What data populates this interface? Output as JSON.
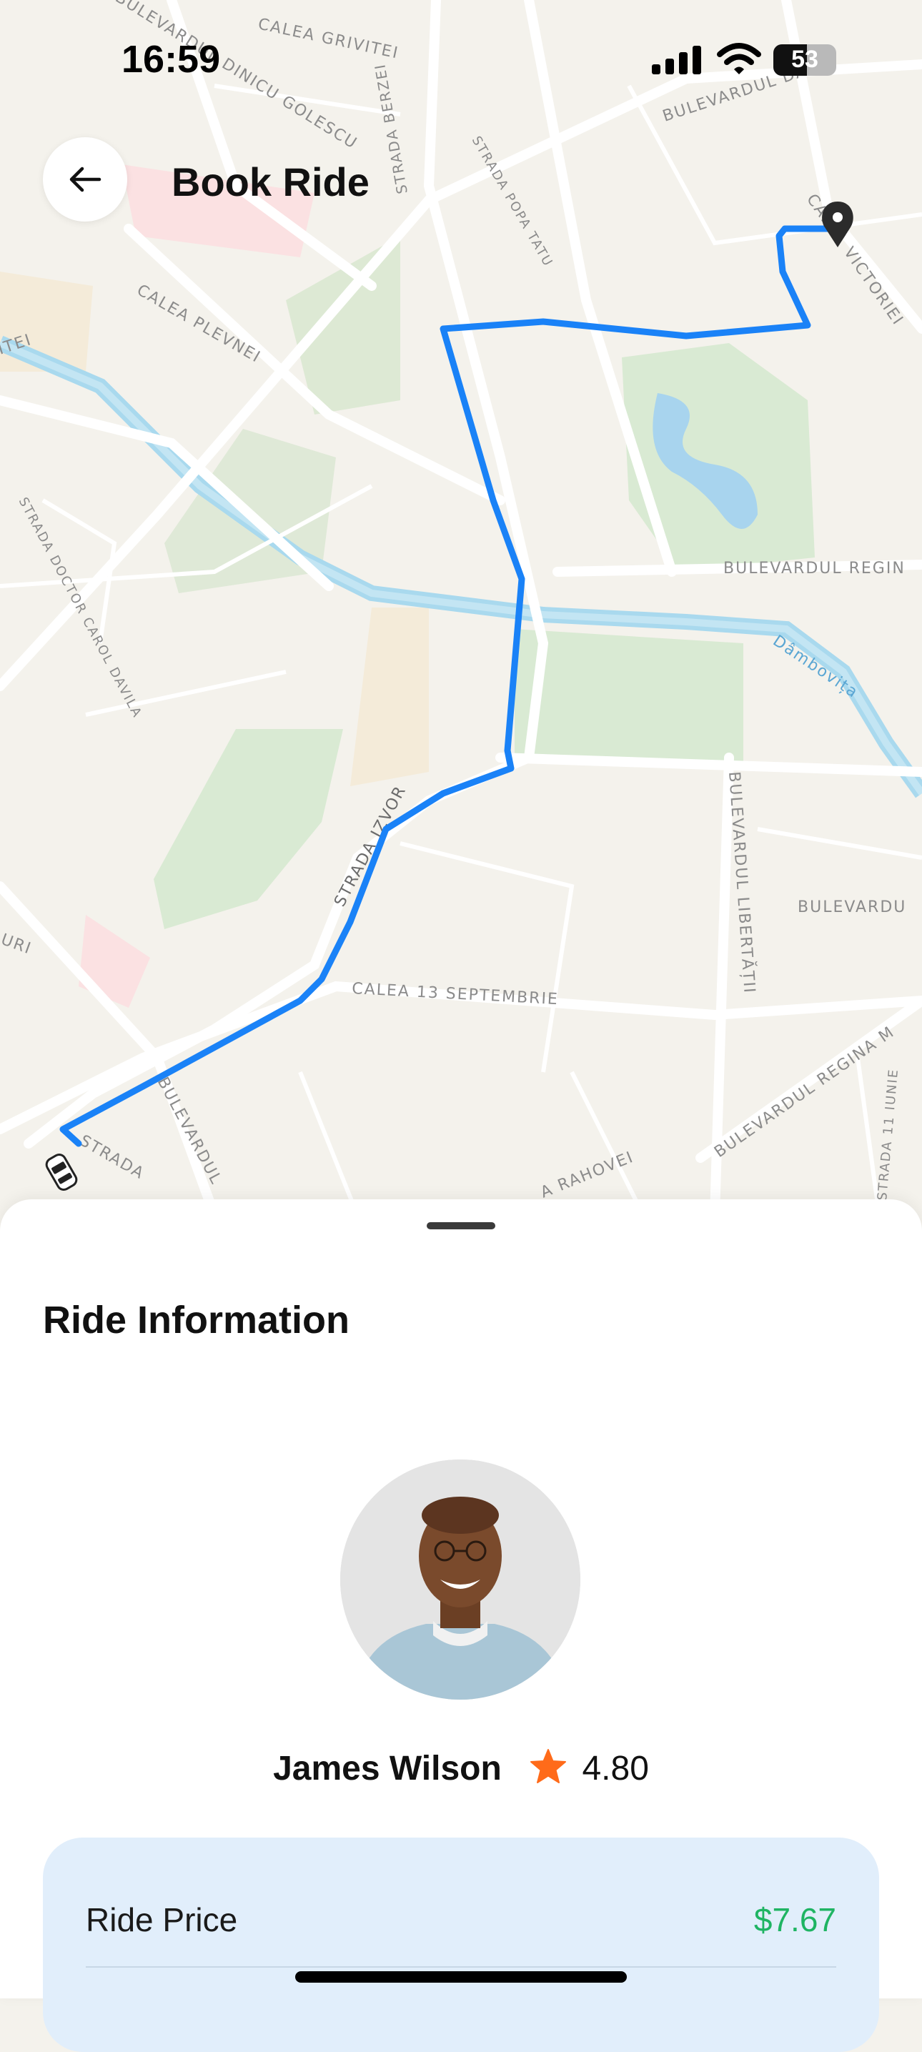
{
  "status_bar": {
    "time": "16:59",
    "battery": "53"
  },
  "header": {
    "title": "Book Ride",
    "back_icon": "arrow-left-icon"
  },
  "map": {
    "labels": {
      "grivitei": "CALEA GRIVITEI",
      "golescu": "BULEVARDUL DINICU GOLESCU",
      "dacia": "BULEVARDUL DACIA",
      "berzei": "STRADA BERZEI",
      "popa_tatu": "STRADA POPA TATU",
      "victoriei": "CALEA VICTORIEI",
      "plevnei": "CALEA PLEVNEI",
      "itei": "ITEI",
      "doctor_davila": "STRADA DOCTOR CAROL DAVILA",
      "regina": "BULEVARDUL REGIN",
      "dambovita": "Dâmbovița",
      "izvor": "STRADA IZVOR",
      "libertatii": "BULEVARDUL LIBERTĂȚII",
      "bulevardu": "BULEVARDU",
      "uri": "URI",
      "calea13": "CALEA 13 SEPTEMBRIE",
      "regina_maria": "BULEVARDUL REGINA M",
      "bulevardul_left": "BULEVARDUL",
      "strada_left": "STRADA",
      "rahovei": "A RAHOVEI",
      "iunie": "STRADA 11 IUNIE"
    },
    "route_color": "#1a82f7",
    "destination_icon": "location-pin-icon",
    "car_icon": "car-icon"
  },
  "sheet": {
    "title": "Ride Information",
    "driver": {
      "name": "James Wilson",
      "rating": "4.80",
      "star_icon": "star-icon",
      "star_color": "#ff6b1a"
    },
    "price": {
      "label": "Ride Price",
      "value": "$7.67",
      "value_color": "#1fb463"
    }
  }
}
